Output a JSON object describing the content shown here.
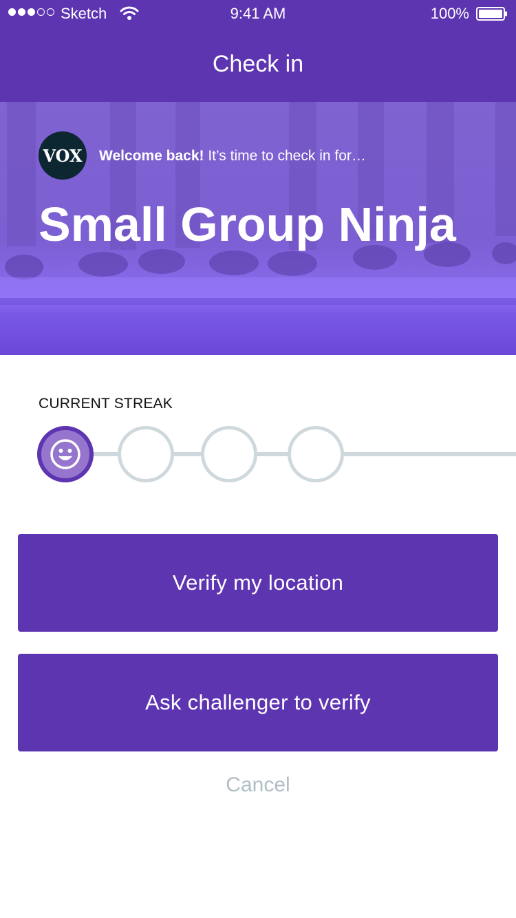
{
  "status_bar": {
    "carrier": "Sketch",
    "time": "9:41 AM",
    "battery": "100%"
  },
  "nav": {
    "title": "Check in"
  },
  "hero": {
    "avatar_text": "VOX",
    "welcome_bold": "Welcome back!",
    "welcome_rest": " It’s time to check in for…",
    "title": "Small Group Ninja"
  },
  "streak": {
    "label": "CURRENT STREAK",
    "completed": 1,
    "total": 4
  },
  "actions": {
    "verify_location": "Verify my location",
    "ask_challenger": "Ask challenger to verify",
    "cancel": "Cancel"
  },
  "colors": {
    "primary": "#5e35b1",
    "streak_active_fill": "#9575cd",
    "streak_inactive": "#cfd8dc",
    "cancel_text": "#b0bec5"
  }
}
